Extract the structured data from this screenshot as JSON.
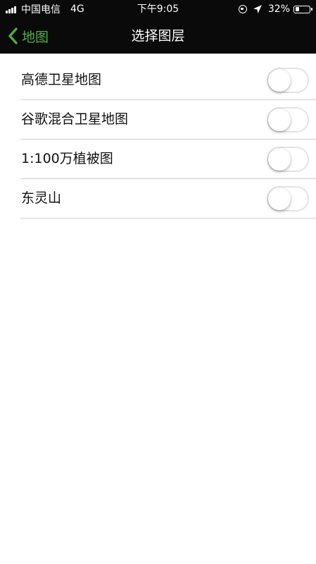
{
  "status_bar": {
    "carrier": "中国电信",
    "network": "4G",
    "time": "下午9:05",
    "battery_percent": "32%",
    "signal_bars_active": 4,
    "battery_level": 0.32,
    "icons": [
      "signal-icon",
      "rotation-lock-icon",
      "location-arrow-icon",
      "battery-icon"
    ]
  },
  "nav": {
    "back_label": "地图",
    "title": "选择图层",
    "back_icon": "chevron-left-icon"
  },
  "colors": {
    "accent": "#4caf3e",
    "bar_background": "#0a0a0a",
    "separator": "#d0d0d0"
  },
  "layers": [
    {
      "label": "高德卫星地图",
      "enabled": false
    },
    {
      "label": "谷歌混合卫星地图",
      "enabled": false
    },
    {
      "label": "1:100万植被图",
      "enabled": false
    },
    {
      "label": "东灵山",
      "enabled": false
    }
  ]
}
